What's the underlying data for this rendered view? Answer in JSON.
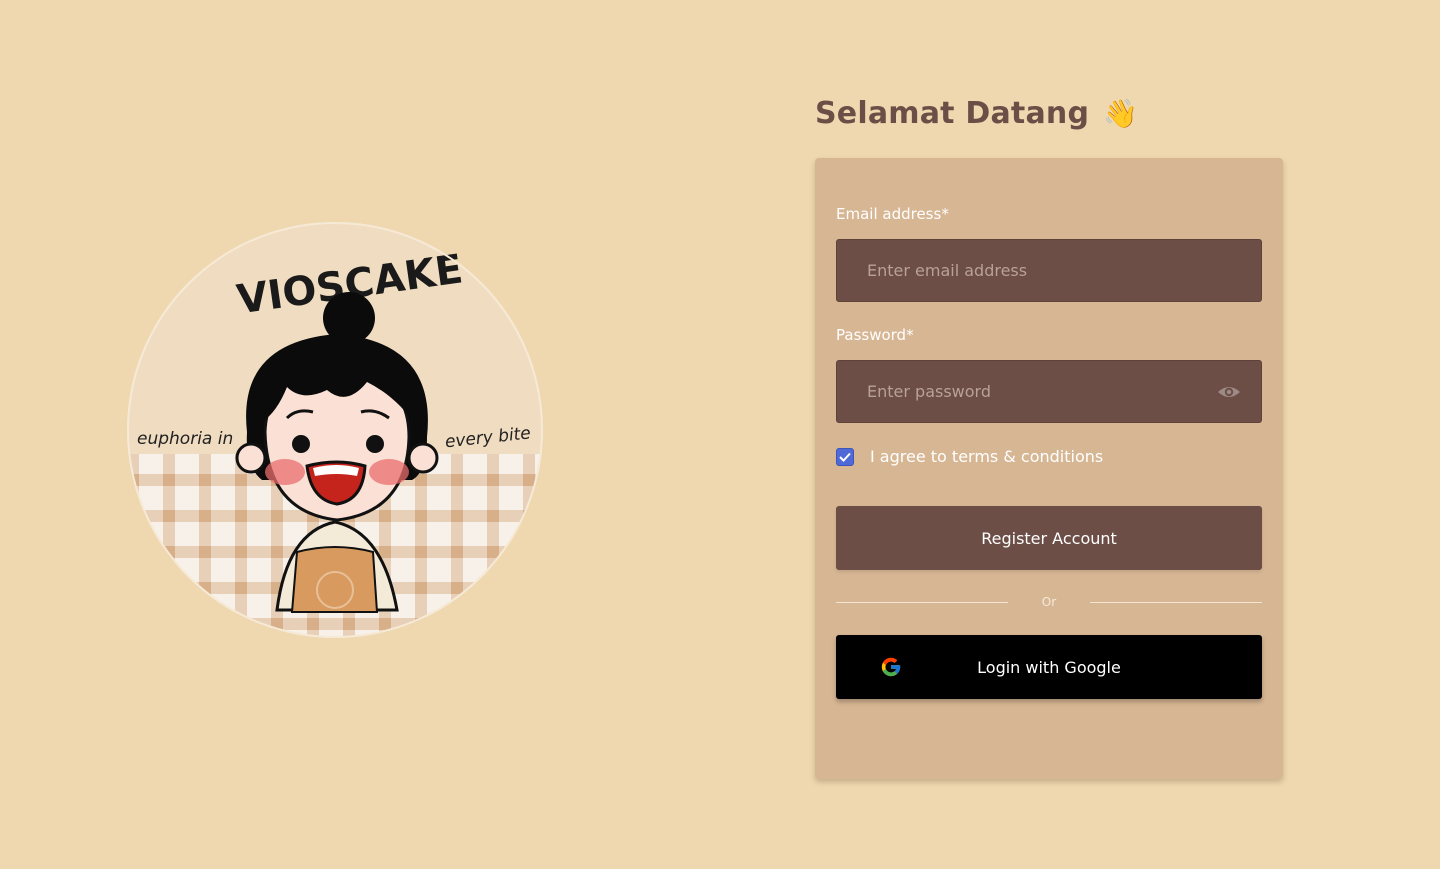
{
  "logo": {
    "brand": "VIOSCAKE",
    "tagline_left": "euphoria in",
    "tagline_right": "every bite"
  },
  "header": {
    "title": "Selamat Datang",
    "wave_emoji": "👋"
  },
  "form": {
    "email_label": "Email address*",
    "email_placeholder": "Enter email address",
    "email_value": "",
    "password_label": "Password*",
    "password_placeholder": "Enter password",
    "password_value": "",
    "terms_label": "I agree to terms & conditions",
    "terms_checked": true,
    "register_label": "Register Account",
    "divider_text": "Or",
    "google_label": "Login with Google"
  },
  "colors": {
    "background": "#efd8b0",
    "card": "#d7b693",
    "input": "#6c4e46",
    "accent_checkbox": "#4f6ad6",
    "title": "#6b4f46"
  }
}
